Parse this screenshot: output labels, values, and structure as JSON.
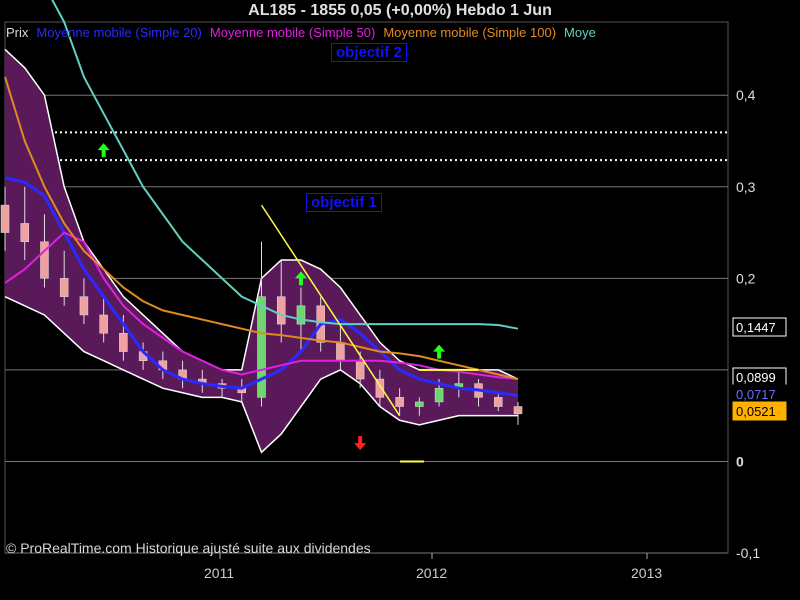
{
  "header": {
    "title": "AL185 - 1855     0,05 (+0,00%)     Hebdo  1 Jun"
  },
  "legend": [
    {
      "label": "Prix",
      "color": "#dddddd"
    },
    {
      "label": "Moyenne mobile (Simple 20)",
      "color": "#2a2aff"
    },
    {
      "label": "Moyenne mobile (Simple 50)",
      "color": "#e020e0"
    },
    {
      "label": "Moyenne mobile (Simple 100)",
      "color": "#e08a20"
    },
    {
      "label": "Moye",
      "color": "#60d0c0"
    }
  ],
  "annotations": {
    "objectif1": "objectif 1",
    "objectif2": "objectif 2",
    "level_a": "0,3595",
    "level_b": "0,3291",
    "copyright": "© ProRealTime.com Historique ajusté suite aux dividendes"
  },
  "price_tags": [
    {
      "text": "0,1447",
      "value": 0.1447,
      "bg": "#000000",
      "fg": "#ffffff",
      "border": "#ffffff"
    },
    {
      "text": "0,0899",
      "value": 0.0899,
      "bg": "#000000",
      "fg": "#ffffff",
      "border": "#ffffff"
    },
    {
      "text": "0,0717",
      "value": 0.0717,
      "bg": "#000000",
      "fg": "#6a6aff",
      "border": "#000000"
    },
    {
      "text": "0,0521",
      "value": 0.0521,
      "bg": "#ffb000",
      "fg": "#000000",
      "border": "#ffb000"
    }
  ],
  "chart_data": {
    "type": "candlestick",
    "title": "AL185 - 1855     0,05 (+0,00%)     Hebdo  1 Jun",
    "x_ticks": [
      "2011",
      "2012",
      "2013"
    ],
    "y_ticks": [
      "0,4",
      "0,3",
      "0,2",
      "0",
      "-0,1"
    ],
    "ylim": [
      -0.1,
      0.48
    ],
    "horizontal_levels": [
      0.3595,
      0.3291
    ],
    "series": [
      {
        "name": "Moyenne mobile (Simple 20)",
        "color": "#2a2aff",
        "values": [
          0.31,
          0.305,
          0.29,
          0.25,
          0.21,
          0.18,
          0.15,
          0.12,
          0.1,
          0.09,
          0.085,
          0.082,
          0.08,
          0.09,
          0.1,
          0.12,
          0.15,
          0.155,
          0.14,
          0.12,
          0.1,
          0.09,
          0.085,
          0.08,
          0.078,
          0.075,
          0.072
        ]
      },
      {
        "name": "Moyenne mobile (Simple 50)",
        "color": "#e020e0",
        "values": [
          0.195,
          0.21,
          0.23,
          0.25,
          0.24,
          0.2,
          0.17,
          0.15,
          0.135,
          0.12,
          0.11,
          0.1,
          0.095,
          0.1,
          0.105,
          0.11,
          0.11,
          0.11,
          0.11,
          0.11,
          0.108,
          0.105,
          0.1,
          0.098,
          0.095,
          0.092,
          0.09
        ]
      },
      {
        "name": "Moyenne mobile (Simple 100)",
        "color": "#e08a20",
        "values": [
          0.42,
          0.35,
          0.3,
          0.26,
          0.23,
          0.21,
          0.19,
          0.175,
          0.165,
          0.16,
          0.155,
          0.15,
          0.145,
          0.14,
          0.138,
          0.135,
          0.132,
          0.13,
          0.125,
          0.12,
          0.118,
          0.115,
          0.11,
          0.105,
          0.1,
          0.095,
          0.09
        ]
      },
      {
        "name": "Moye",
        "color": "#60d0c0",
        "values": [
          0.7,
          0.62,
          0.55,
          0.48,
          0.42,
          0.38,
          0.34,
          0.3,
          0.27,
          0.24,
          0.22,
          0.2,
          0.18,
          0.17,
          0.16,
          0.155,
          0.152,
          0.15,
          0.15,
          0.15,
          0.15,
          0.15,
          0.15,
          0.15,
          0.15,
          0.149,
          0.145
        ]
      }
    ],
    "bollinger": {
      "upper": [
        0.45,
        0.43,
        0.4,
        0.3,
        0.24,
        0.21,
        0.18,
        0.16,
        0.14,
        0.12,
        0.11,
        0.1,
        0.1,
        0.2,
        0.22,
        0.22,
        0.21,
        0.19,
        0.16,
        0.13,
        0.11,
        0.1,
        0.1,
        0.1,
        0.1,
        0.1,
        0.09
      ],
      "lower": [
        0.18,
        0.17,
        0.16,
        0.14,
        0.12,
        0.11,
        0.1,
        0.09,
        0.08,
        0.075,
        0.07,
        0.07,
        0.065,
        0.01,
        0.03,
        0.06,
        0.09,
        0.1,
        0.085,
        0.06,
        0.045,
        0.04,
        0.045,
        0.05,
        0.05,
        0.05,
        0.05
      ]
    },
    "candles": [
      {
        "o": 0.28,
        "h": 0.3,
        "l": 0.23,
        "c": 0.25
      },
      {
        "o": 0.26,
        "h": 0.3,
        "l": 0.22,
        "c": 0.24
      },
      {
        "o": 0.24,
        "h": 0.27,
        "l": 0.19,
        "c": 0.2
      },
      {
        "o": 0.2,
        "h": 0.23,
        "l": 0.17,
        "c": 0.18
      },
      {
        "o": 0.18,
        "h": 0.2,
        "l": 0.15,
        "c": 0.16
      },
      {
        "o": 0.16,
        "h": 0.18,
        "l": 0.13,
        "c": 0.14
      },
      {
        "o": 0.14,
        "h": 0.16,
        "l": 0.11,
        "c": 0.12
      },
      {
        "o": 0.12,
        "h": 0.13,
        "l": 0.1,
        "c": 0.11
      },
      {
        "o": 0.11,
        "h": 0.12,
        "l": 0.09,
        "c": 0.1
      },
      {
        "o": 0.1,
        "h": 0.11,
        "l": 0.08,
        "c": 0.09
      },
      {
        "o": 0.09,
        "h": 0.1,
        "l": 0.075,
        "c": 0.085
      },
      {
        "o": 0.085,
        "h": 0.09,
        "l": 0.07,
        "c": 0.08
      },
      {
        "o": 0.08,
        "h": 0.09,
        "l": 0.065,
        "c": 0.075
      },
      {
        "o": 0.07,
        "h": 0.24,
        "l": 0.06,
        "c": 0.18
      },
      {
        "o": 0.18,
        "h": 0.22,
        "l": 0.13,
        "c": 0.15
      },
      {
        "o": 0.15,
        "h": 0.19,
        "l": 0.12,
        "c": 0.17
      },
      {
        "o": 0.17,
        "h": 0.18,
        "l": 0.12,
        "c": 0.13
      },
      {
        "o": 0.13,
        "h": 0.15,
        "l": 0.1,
        "c": 0.11
      },
      {
        "o": 0.11,
        "h": 0.12,
        "l": 0.08,
        "c": 0.09
      },
      {
        "o": 0.09,
        "h": 0.1,
        "l": 0.06,
        "c": 0.07
      },
      {
        "o": 0.07,
        "h": 0.08,
        "l": 0.05,
        "c": 0.06
      },
      {
        "o": 0.06,
        "h": 0.07,
        "l": 0.05,
        "c": 0.065
      },
      {
        "o": 0.065,
        "h": 0.09,
        "l": 0.06,
        "c": 0.08
      },
      {
        "o": 0.08,
        "h": 0.1,
        "l": 0.07,
        "c": 0.085
      },
      {
        "o": 0.085,
        "h": 0.09,
        "l": 0.06,
        "c": 0.07
      },
      {
        "o": 0.07,
        "h": 0.075,
        "l": 0.055,
        "c": 0.06
      },
      {
        "o": 0.06,
        "h": 0.065,
        "l": 0.04,
        "c": 0.052
      }
    ],
    "signals": [
      {
        "index": 5,
        "value": 0.34,
        "dir": "up"
      },
      {
        "index": 15,
        "value": 0.2,
        "dir": "up"
      },
      {
        "index": 22,
        "value": 0.12,
        "dir": "up"
      },
      {
        "index": 18,
        "value": 0.02,
        "dir": "down"
      }
    ]
  }
}
